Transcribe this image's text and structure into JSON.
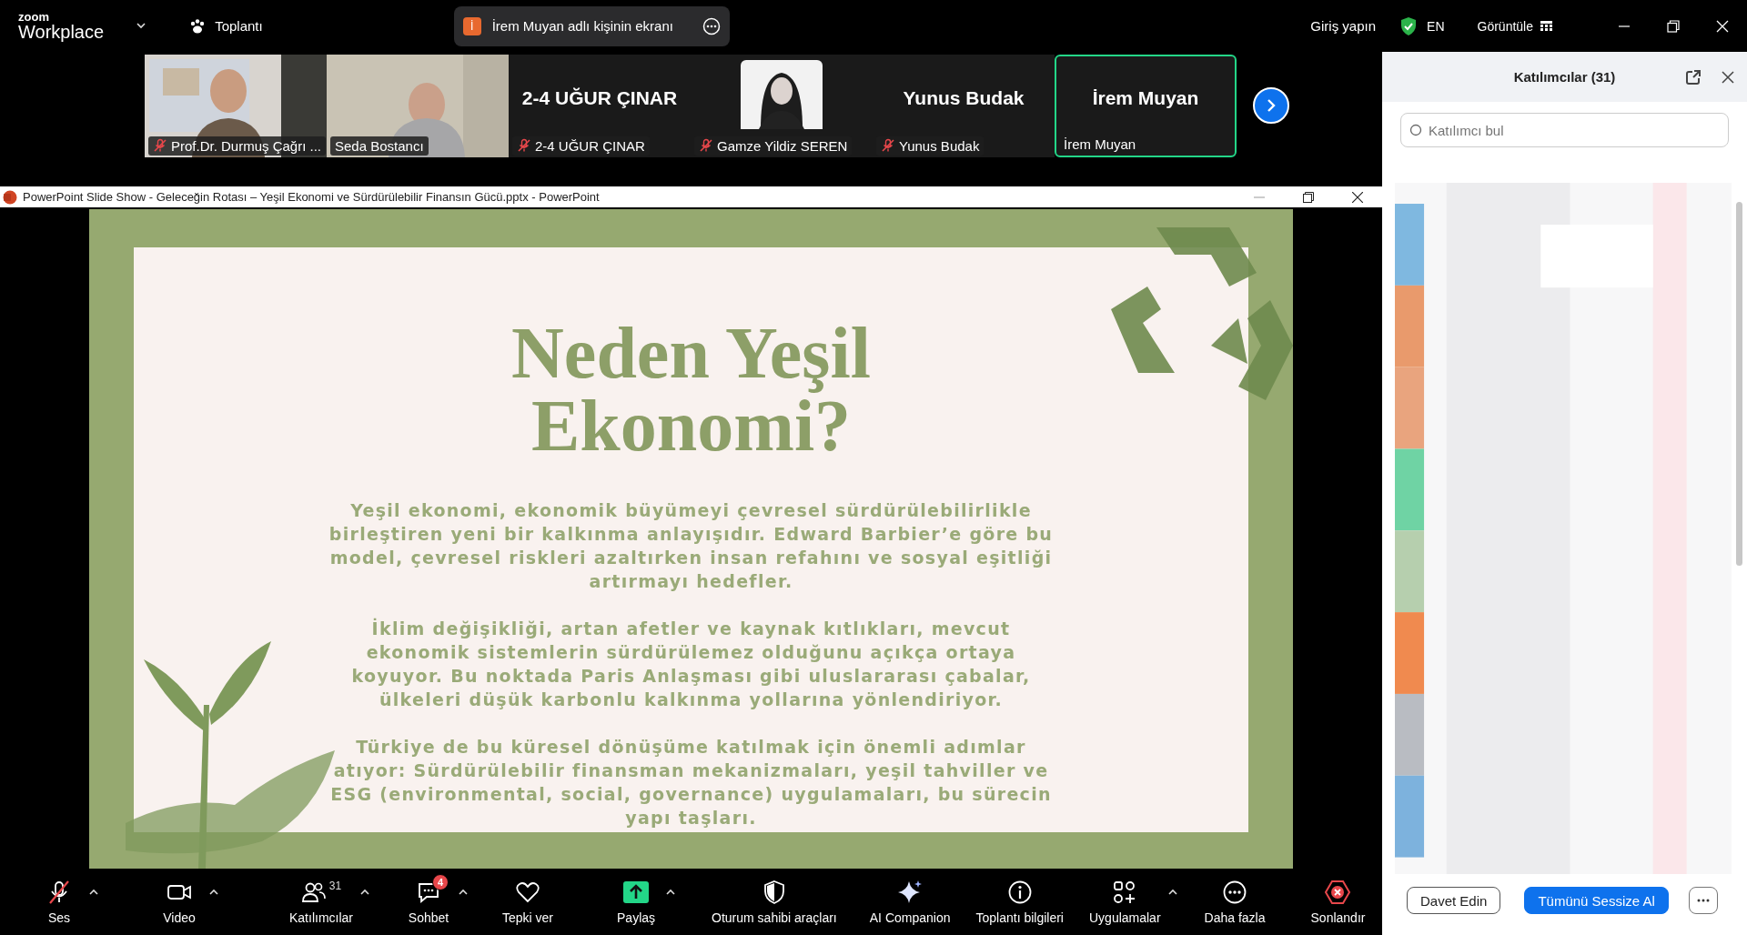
{
  "top_bar": {
    "logo_top": "zoom",
    "logo_bottom": "Workplace",
    "meeting_menu": "Toplantı",
    "share_banner": {
      "initial": "İ",
      "text": "İrem Muyan adlı kişinin ekranı"
    },
    "sign_in": "Giriş yapın",
    "language": "EN",
    "view": "Görüntüle"
  },
  "gallery": [
    {
      "kind": "video",
      "label": "Prof.Dr. Durmuş Çağrı ...",
      "muted": true,
      "active": false
    },
    {
      "kind": "video",
      "label": "Seda Bostancı",
      "muted": false,
      "active": false
    },
    {
      "kind": "name",
      "title": "2-4 UĞUR ÇINAR",
      "label": "2-4 UĞUR ÇINAR",
      "muted": true,
      "active": false
    },
    {
      "label": "Gamze Yildiz SEREN",
      "muted": true,
      "active": false
    },
    {
      "kind": "name",
      "title": "Yunus Budak",
      "label": "Yunus Budak",
      "muted": true,
      "active": false
    },
    {
      "kind": "name",
      "title": "İrem Muyan",
      "label": "İrem Muyan",
      "muted": false,
      "active": true
    }
  ],
  "slide_window": {
    "title": "PowerPoint Slide Show  -  Geleceğin Rotası – Yeşil Ekonomi ve Sürdürülebilir Finansın Gücü.pptx - PowerPoint",
    "slide": {
      "title": "Neden Yeşil Ekonomi?",
      "paragraphs": [
        "Yeşil ekonomi, ekonomik büyümeyi çevresel sürdürülebilirlikle birleştiren yeni bir kalkınma anlayışıdır. Edward Barbier’e göre bu model, çevresel riskleri azaltırken insan refahını ve sosyal eşitliği artırmayı hedefler.",
        "İklim değişikliği, artan afetler ve kaynak kıtlıkları, mevcut ekonomik sistemlerin sürdürülemez olduğunu açıkça ortaya koyuyor. Bu noktada Paris Anlaşması gibi uluslararası çabalar, ülkeleri düşük karbonlu kalkınma yollarına yönlendiriyor.",
        "Türkiye de bu küresel dönüşüme katılmak için önemli adımlar atıyor: Sürdürülebilir finansman mekanizmaları, yeşil tahviller ve ESG (environmental, social, governance) uygulamaları, bu sürecin yapı taşları."
      ]
    }
  },
  "panel": {
    "title": "Katılımcılar (31)",
    "search": {
      "placeholder": "Katılımcı bul"
    },
    "buttons": [
      {
        "kind": "outline",
        "label": "Davet Edin"
      },
      {
        "kind": "primary",
        "label": "Tümünü Sessize Al"
      },
      {
        "kind": "more"
      }
    ]
  },
  "toolbar": [
    {
      "kind": "audio",
      "label": "Ses",
      "caret": true
    },
    {
      "kind": "video",
      "label": "Video",
      "caret": true
    },
    {
      "kind": "participants",
      "label": "Katılımcılar",
      "count": "31",
      "caret": true
    },
    {
      "kind": "chat",
      "label": "Sohbet",
      "badge": "4",
      "caret": true
    },
    {
      "kind": "reaction",
      "label": "Tepki ver",
      "caret": false
    },
    {
      "kind": "share",
      "label": "Paylaş",
      "caret": true
    },
    {
      "kind": "host",
      "label": "Oturum sahibi araçları",
      "caret": false
    },
    {
      "kind": "companion",
      "label": "AI Companion",
      "caret": false
    },
    {
      "kind": "info",
      "label": "Toplantı bilgileri",
      "caret": false
    },
    {
      "kind": "apps",
      "label": "Uygulamalar",
      "caret": true
    },
    {
      "kind": "more",
      "label": "Daha fazla",
      "caret": false
    },
    {
      "kind": "end",
      "label": "Sonlandır",
      "caret": false
    }
  ]
}
